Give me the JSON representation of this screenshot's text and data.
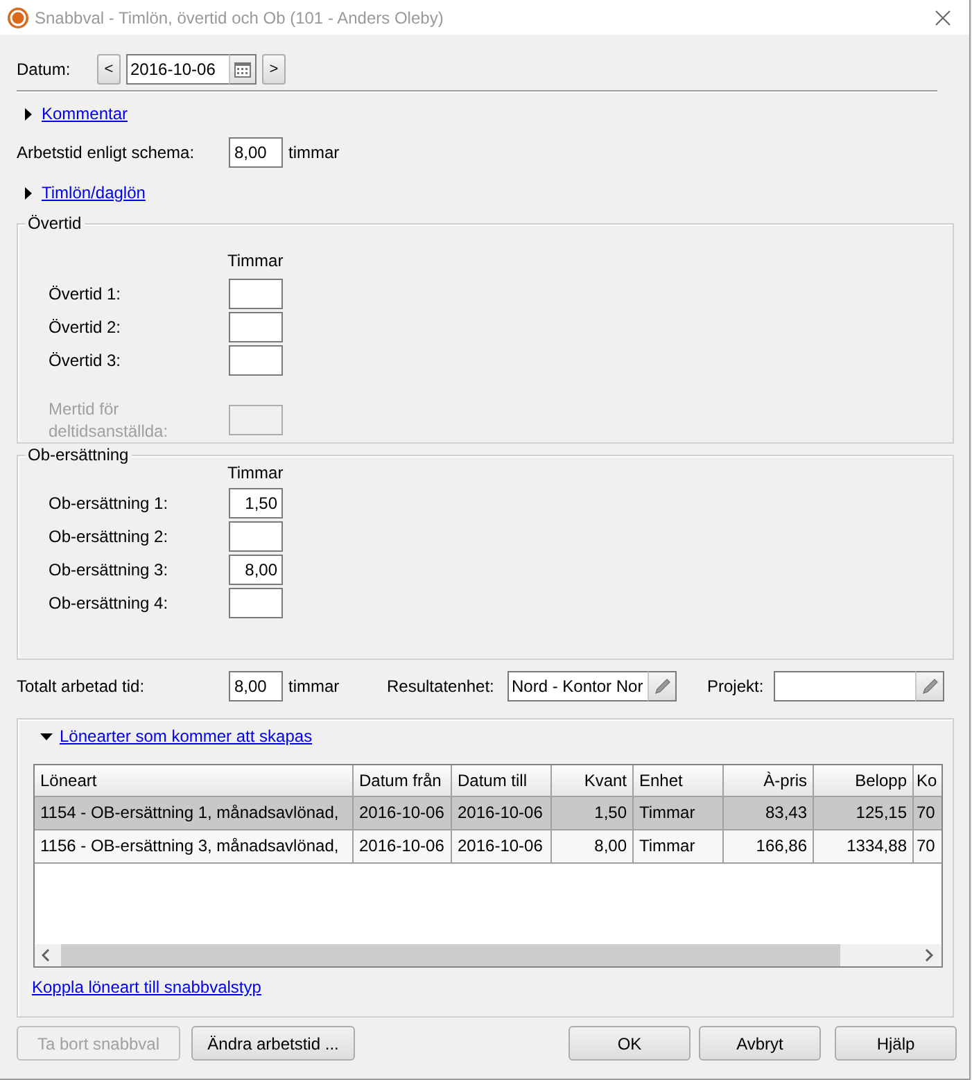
{
  "window": {
    "title": "Snabbval - Timlön, övertid och Ob (101 - Anders Oleby)"
  },
  "date": {
    "label": "Datum:",
    "value": "2016-10-06",
    "prev": "<",
    "next": ">"
  },
  "comment_expander": {
    "label": "Kommentar",
    "expanded": false
  },
  "schedule": {
    "label": "Arbetstid enligt schema:",
    "value": "8,00",
    "unit": "timmar"
  },
  "wage_expander": {
    "label": "Timlön/daglön",
    "expanded": false
  },
  "overtime": {
    "title": "Övertid",
    "column": "Timmar",
    "rows": [
      {
        "label": "Övertid 1:",
        "disabled": false
      },
      {
        "label": "Övertid 2:",
        "disabled": false
      },
      {
        "label": "Övertid 3:",
        "disabled": false
      },
      {
        "label": "Mertid för deltidsanställda:",
        "disabled": true
      }
    ]
  },
  "ob": {
    "title": "Ob-ersättning",
    "column": "Timmar",
    "rows": [
      {
        "label": "Ob-ersättning 1:",
        "value": "1,50",
        "disabled": false
      },
      {
        "label": "Ob-ersättning 2:",
        "disabled": false
      },
      {
        "label": "Ob-ersättning 3:",
        "value": "8,00",
        "disabled": false
      },
      {
        "label": "Ob-ersättning 4:",
        "disabled": false
      }
    ]
  },
  "total": {
    "label": "Totalt arbetad tid:",
    "value": "8,00",
    "unit": "timmar"
  },
  "result_unit": {
    "label": "Resultatenhet:",
    "value": "Nord - Kontor Nor"
  },
  "project": {
    "label": "Projekt:"
  },
  "wage_types": {
    "label": "Lönearter som kommer att skapas",
    "expanded": true,
    "table": {
      "columns": [
        {
          "label": "Löneart",
          "kind": "text"
        },
        {
          "label": "Datum från",
          "kind": "text"
        },
        {
          "label": "Datum till",
          "kind": "text"
        },
        {
          "label": "Kvant",
          "kind": "number"
        },
        {
          "label": "Enhet",
          "kind": "text"
        },
        {
          "label": "À-pris",
          "kind": "number"
        },
        {
          "label": "Belopp",
          "kind": "number"
        },
        {
          "label": "Ko",
          "kind": "text"
        }
      ],
      "rows": [
        {
          "selected": true,
          "cells": [
            "1154 - OB-ersättning 1, månadsavlönad,",
            "2016-10-06",
            "2016-10-06",
            "1,50",
            "Timmar",
            "83,43",
            "125,15",
            "70"
          ]
        },
        {
          "selected": false,
          "cells": [
            "1156 - OB-ersättning 3, månadsavlönad,",
            "2016-10-06",
            "2016-10-06",
            "8,00",
            "Timmar",
            "166,86",
            "1334,88",
            "70"
          ]
        }
      ]
    },
    "link": "Koppla löneart till snabbvalstyp"
  },
  "buttons": [
    {
      "label": "Ta bort snabbval",
      "disabled": true,
      "kind": "left"
    },
    {
      "label": "Ändra arbetstid ...",
      "disabled": false,
      "kind": "left"
    },
    {
      "label": "OK",
      "disabled": false,
      "kind": "right"
    },
    {
      "label": "Avbryt",
      "disabled": false,
      "kind": "right"
    },
    {
      "label": "Hjälp",
      "disabled": false,
      "kind": "right"
    }
  ]
}
